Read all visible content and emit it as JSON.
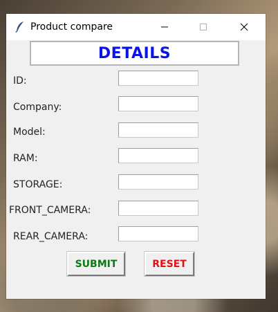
{
  "window": {
    "title": "Product compare",
    "icon": "feather-icon"
  },
  "header": {
    "title": "DETAILS"
  },
  "form": {
    "fields": [
      {
        "label": "ID:",
        "value": ""
      },
      {
        "label": "Company:",
        "value": ""
      },
      {
        "label": "Model:",
        "value": ""
      },
      {
        "label": "RAM:",
        "value": ""
      },
      {
        "label": "STORAGE:",
        "value": ""
      },
      {
        "label": "FRONT_CAMERA:",
        "value": ""
      },
      {
        "label": "REAR_CAMERA:",
        "value": ""
      }
    ]
  },
  "buttons": {
    "submit_label": "SUBMIT",
    "reset_label": "RESET"
  },
  "colors": {
    "header_text": "#0a14e6",
    "submit_text": "#0b7a12",
    "reset_text": "#e01010",
    "window_bg": "#f0f0f0"
  }
}
